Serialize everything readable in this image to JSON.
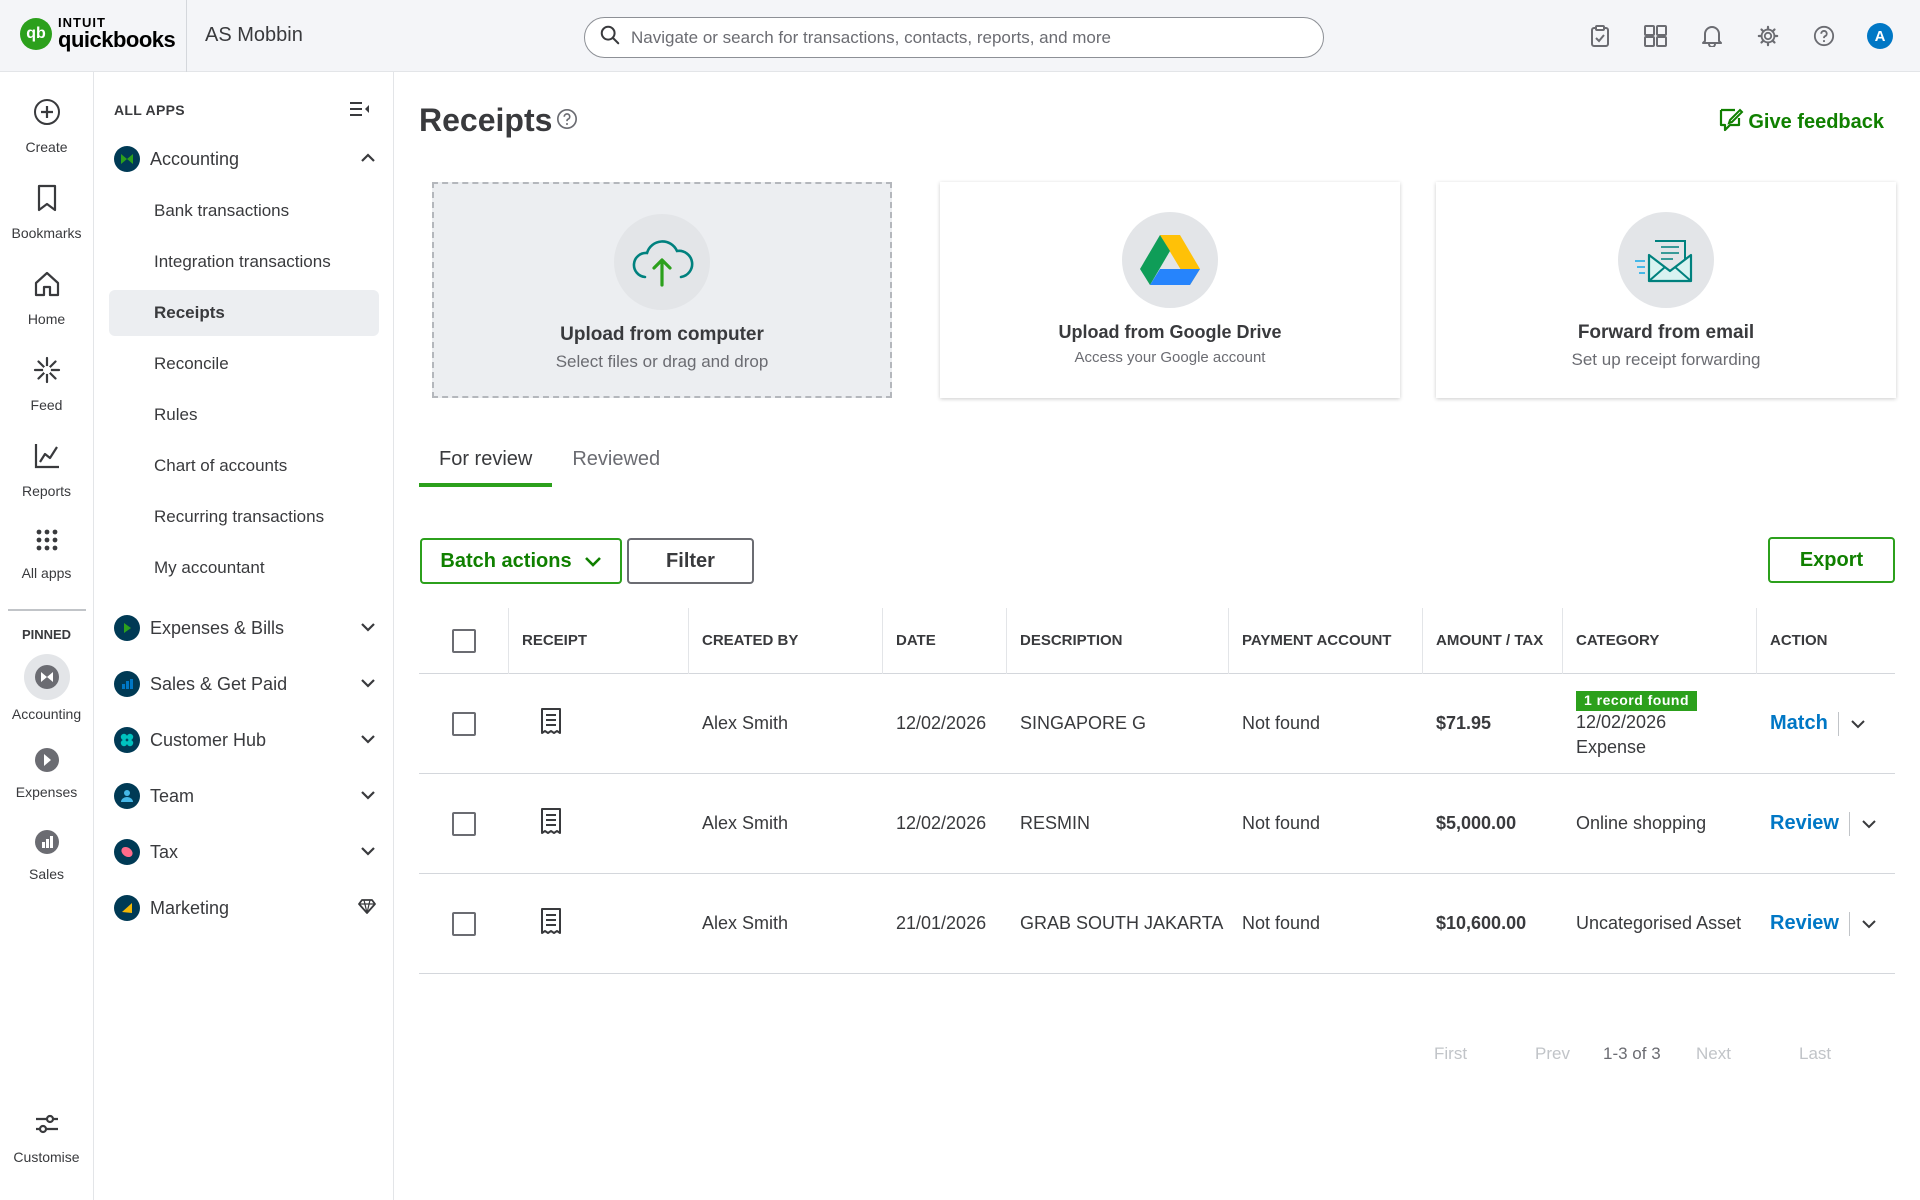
{
  "brand": {
    "line1": "INTUIT",
    "line2": "quickbooks",
    "badge": "qb"
  },
  "company": "AS Mobbin",
  "search": {
    "placeholder": "Navigate or search for transactions, contacts, reports, and more"
  },
  "avatar_initial": "A",
  "rail": {
    "items": [
      {
        "label": "Create"
      },
      {
        "label": "Bookmarks"
      },
      {
        "label": "Home"
      },
      {
        "label": "Feed"
      },
      {
        "label": "Reports"
      },
      {
        "label": "All apps"
      }
    ],
    "pinned_label": "PINNED",
    "pinned": [
      {
        "label": "Accounting"
      },
      {
        "label": "Expenses"
      },
      {
        "label": "Sales"
      }
    ],
    "customise": "Customise"
  },
  "sidebar": {
    "header": "ALL APPS",
    "groups": [
      {
        "label": "Accounting",
        "color": "#003a55"
      },
      {
        "label": "Expenses & Bills",
        "color": "#2ca01c"
      },
      {
        "label": "Sales & Get Paid",
        "color": "#0077c5"
      },
      {
        "label": "Customer Hub",
        "color": "#00a3a5"
      },
      {
        "label": "Team",
        "color": "#0077c5"
      },
      {
        "label": "Tax",
        "color": "#e5597d"
      },
      {
        "label": "Marketing",
        "color": "#f2b705"
      }
    ],
    "accounting_items": [
      {
        "label": "Bank transactions"
      },
      {
        "label": "Integration transactions"
      },
      {
        "label": "Receipts"
      },
      {
        "label": "Reconcile"
      },
      {
        "label": "Rules"
      },
      {
        "label": "Chart of accounts"
      },
      {
        "label": "Recurring transactions"
      },
      {
        "label": "My accountant"
      }
    ]
  },
  "page": {
    "title": "Receipts",
    "feedback": "Give feedback"
  },
  "cards": [
    {
      "title": "Upload from computer",
      "subtitle": "Select files or drag and drop"
    },
    {
      "title": "Upload from Google Drive",
      "subtitle": "Access your Google account"
    },
    {
      "title": "Forward from email",
      "subtitle": "Set up receipt forwarding"
    }
  ],
  "tabs": [
    {
      "label": "For review"
    },
    {
      "label": "Reviewed"
    }
  ],
  "buttons": {
    "batch": "Batch actions",
    "filter": "Filter",
    "export": "Export"
  },
  "table": {
    "headers": [
      "RECEIPT",
      "CREATED BY",
      "DATE",
      "DESCRIPTION",
      "PAYMENT ACCOUNT",
      "AMOUNT / TAX",
      "CATEGORY",
      "ACTION"
    ],
    "rows": [
      {
        "created_by": "Alex Smith",
        "date": "12/02/2026",
        "description": "SINGAPORE G",
        "payment_account": "Not found",
        "amount": "$71.95",
        "badge": "1 record found",
        "category_line1": "12/02/2026",
        "category_line2": "Expense",
        "action": "Match"
      },
      {
        "created_by": "Alex Smith",
        "date": "12/02/2026",
        "description": "RESMIN",
        "payment_account": "Not found",
        "amount": "$5,000.00",
        "category": "Online shopping",
        "action": "Review"
      },
      {
        "created_by": "Alex Smith",
        "date": "21/01/2026",
        "description": "GRAB SOUTH JAKARTA",
        "payment_account": "Not found",
        "amount": "$10,600.00",
        "category": "Uncategorised Asset",
        "action": "Review"
      }
    ]
  },
  "pagination": {
    "first": "First",
    "prev": "Prev",
    "range": "1-3 of 3",
    "next": "Next",
    "last": "Last"
  },
  "colors": {
    "brand_green": "#2ca01c",
    "link_blue": "#0077c5",
    "dark_text": "#393a3d"
  }
}
